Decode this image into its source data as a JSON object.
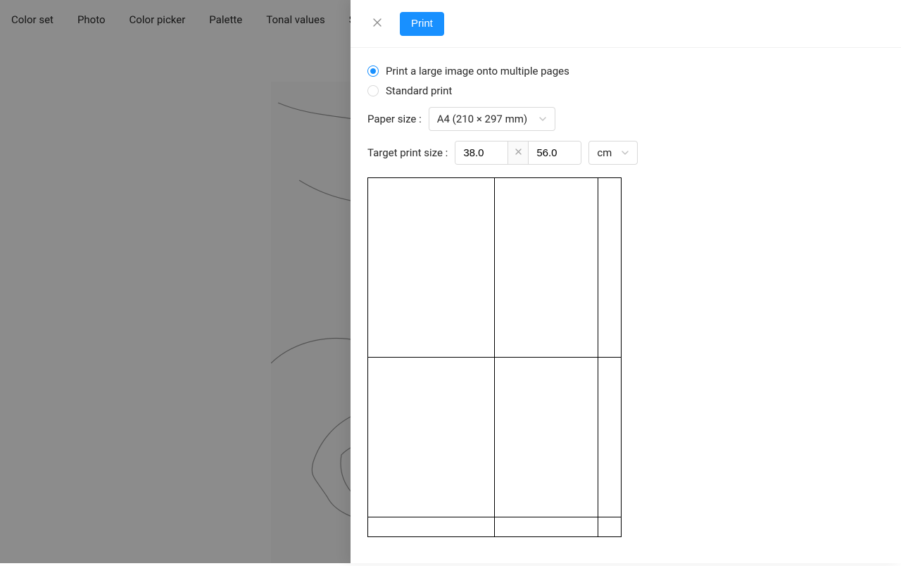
{
  "tabs": {
    "colorset": "Color set",
    "photo": "Photo",
    "colorpicker": "Color picker",
    "palette": "Palette",
    "tonal": "Tonal values",
    "sketch": "Sketch"
  },
  "drawer": {
    "print_button": "Print",
    "option_multi": "Print a large image onto multiple pages",
    "option_standard": "Standard print",
    "paper_label": "Paper size :",
    "paper_selected": "A4 (210 × 297 mm)",
    "target_label": "Target print size :",
    "width_value": "38.0",
    "height_value": "56.0",
    "unit_selected": "cm"
  }
}
